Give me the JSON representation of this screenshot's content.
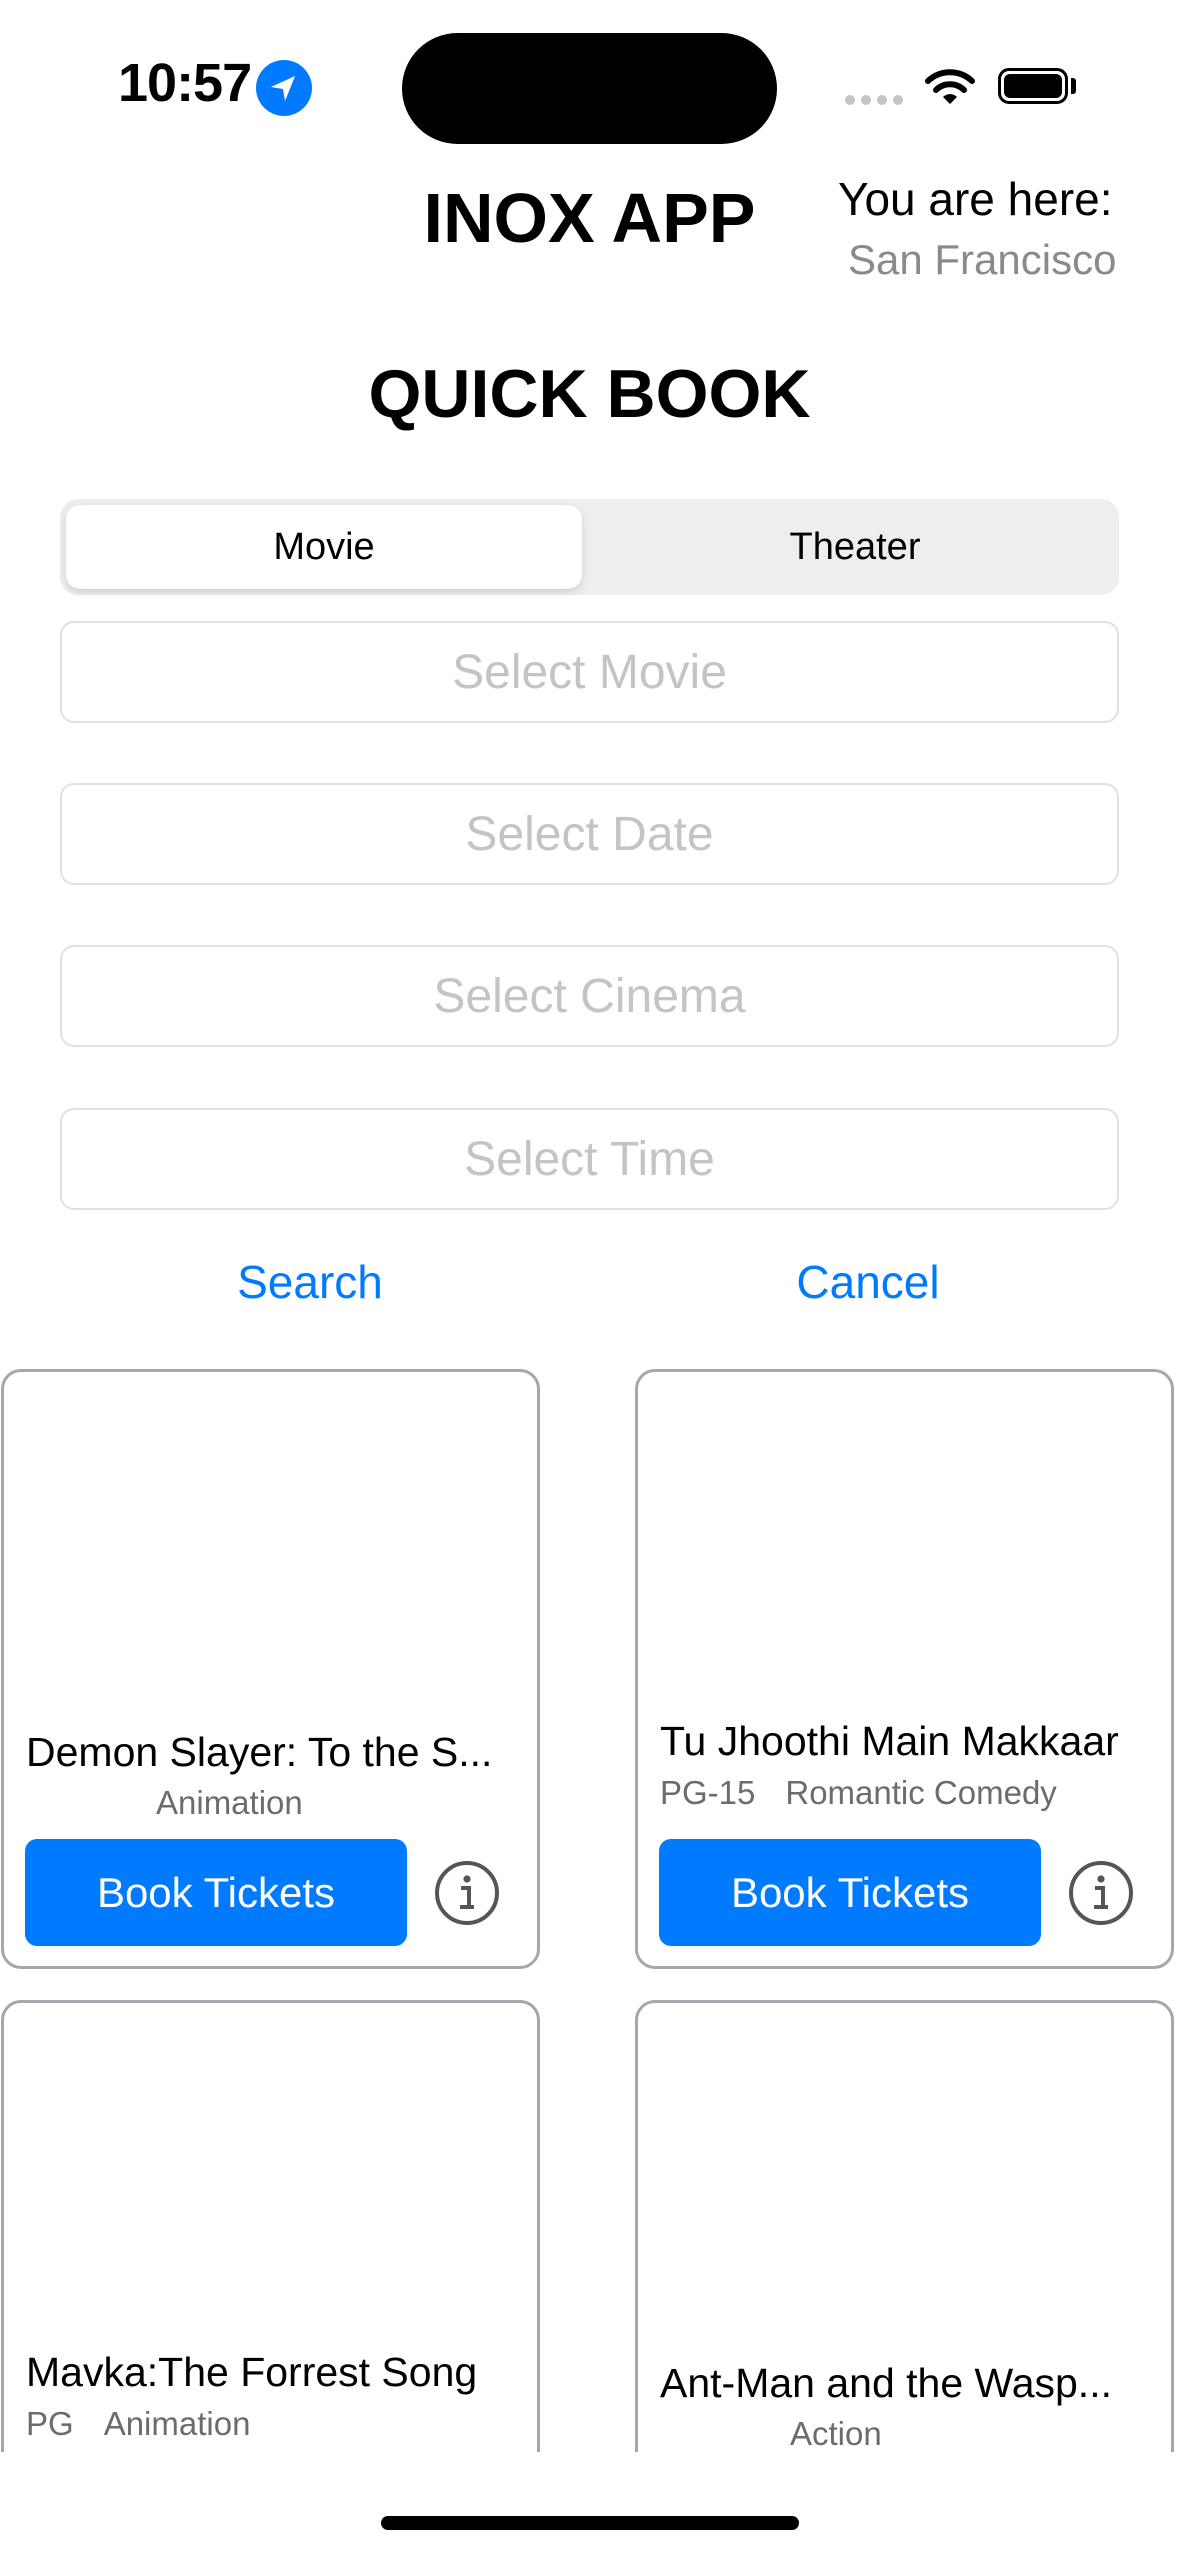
{
  "status_bar": {
    "time": "10:57",
    "icons": [
      "location-arrow-icon",
      "cellular-signal-icon",
      "wifi-icon",
      "battery-icon"
    ]
  },
  "header": {
    "title": "INOX APP",
    "location_label": "You are here:",
    "location_city": "San Francisco"
  },
  "quick_book": {
    "title": "QUICK BOOK",
    "segments": [
      {
        "label": "Movie",
        "selected": true
      },
      {
        "label": "Theater",
        "selected": false
      }
    ],
    "fields": [
      {
        "placeholder": "Select Movie",
        "value": ""
      },
      {
        "placeholder": "Select Date",
        "value": ""
      },
      {
        "placeholder": "Select Cinema",
        "value": ""
      },
      {
        "placeholder": "Select Time",
        "value": ""
      }
    ],
    "search_label": "Search",
    "cancel_label": "Cancel"
  },
  "movies": [
    {
      "title": "Demon Slayer: To the S...",
      "rating": "",
      "genre": "Animation",
      "book_label": "Book Tickets",
      "info_icon": "info-circle-icon"
    },
    {
      "title": "Tu Jhoothi Main Makkaar",
      "rating": "PG-15",
      "genre": "Romantic Comedy",
      "book_label": "Book Tickets",
      "info_icon": "info-circle-icon"
    },
    {
      "title": "Mavka:The Forrest Song",
      "rating": "PG",
      "genre": "Animation"
    },
    {
      "title": "Ant-Man and the Wasp...",
      "rating": "",
      "genre": "Action"
    }
  ],
  "colors": {
    "accent": "#007aff",
    "field_border": "#e1e1e5",
    "placeholder": "#c4c4c7",
    "card_border": "#a7a7ab",
    "secondary_text": "#8a8a8e"
  }
}
